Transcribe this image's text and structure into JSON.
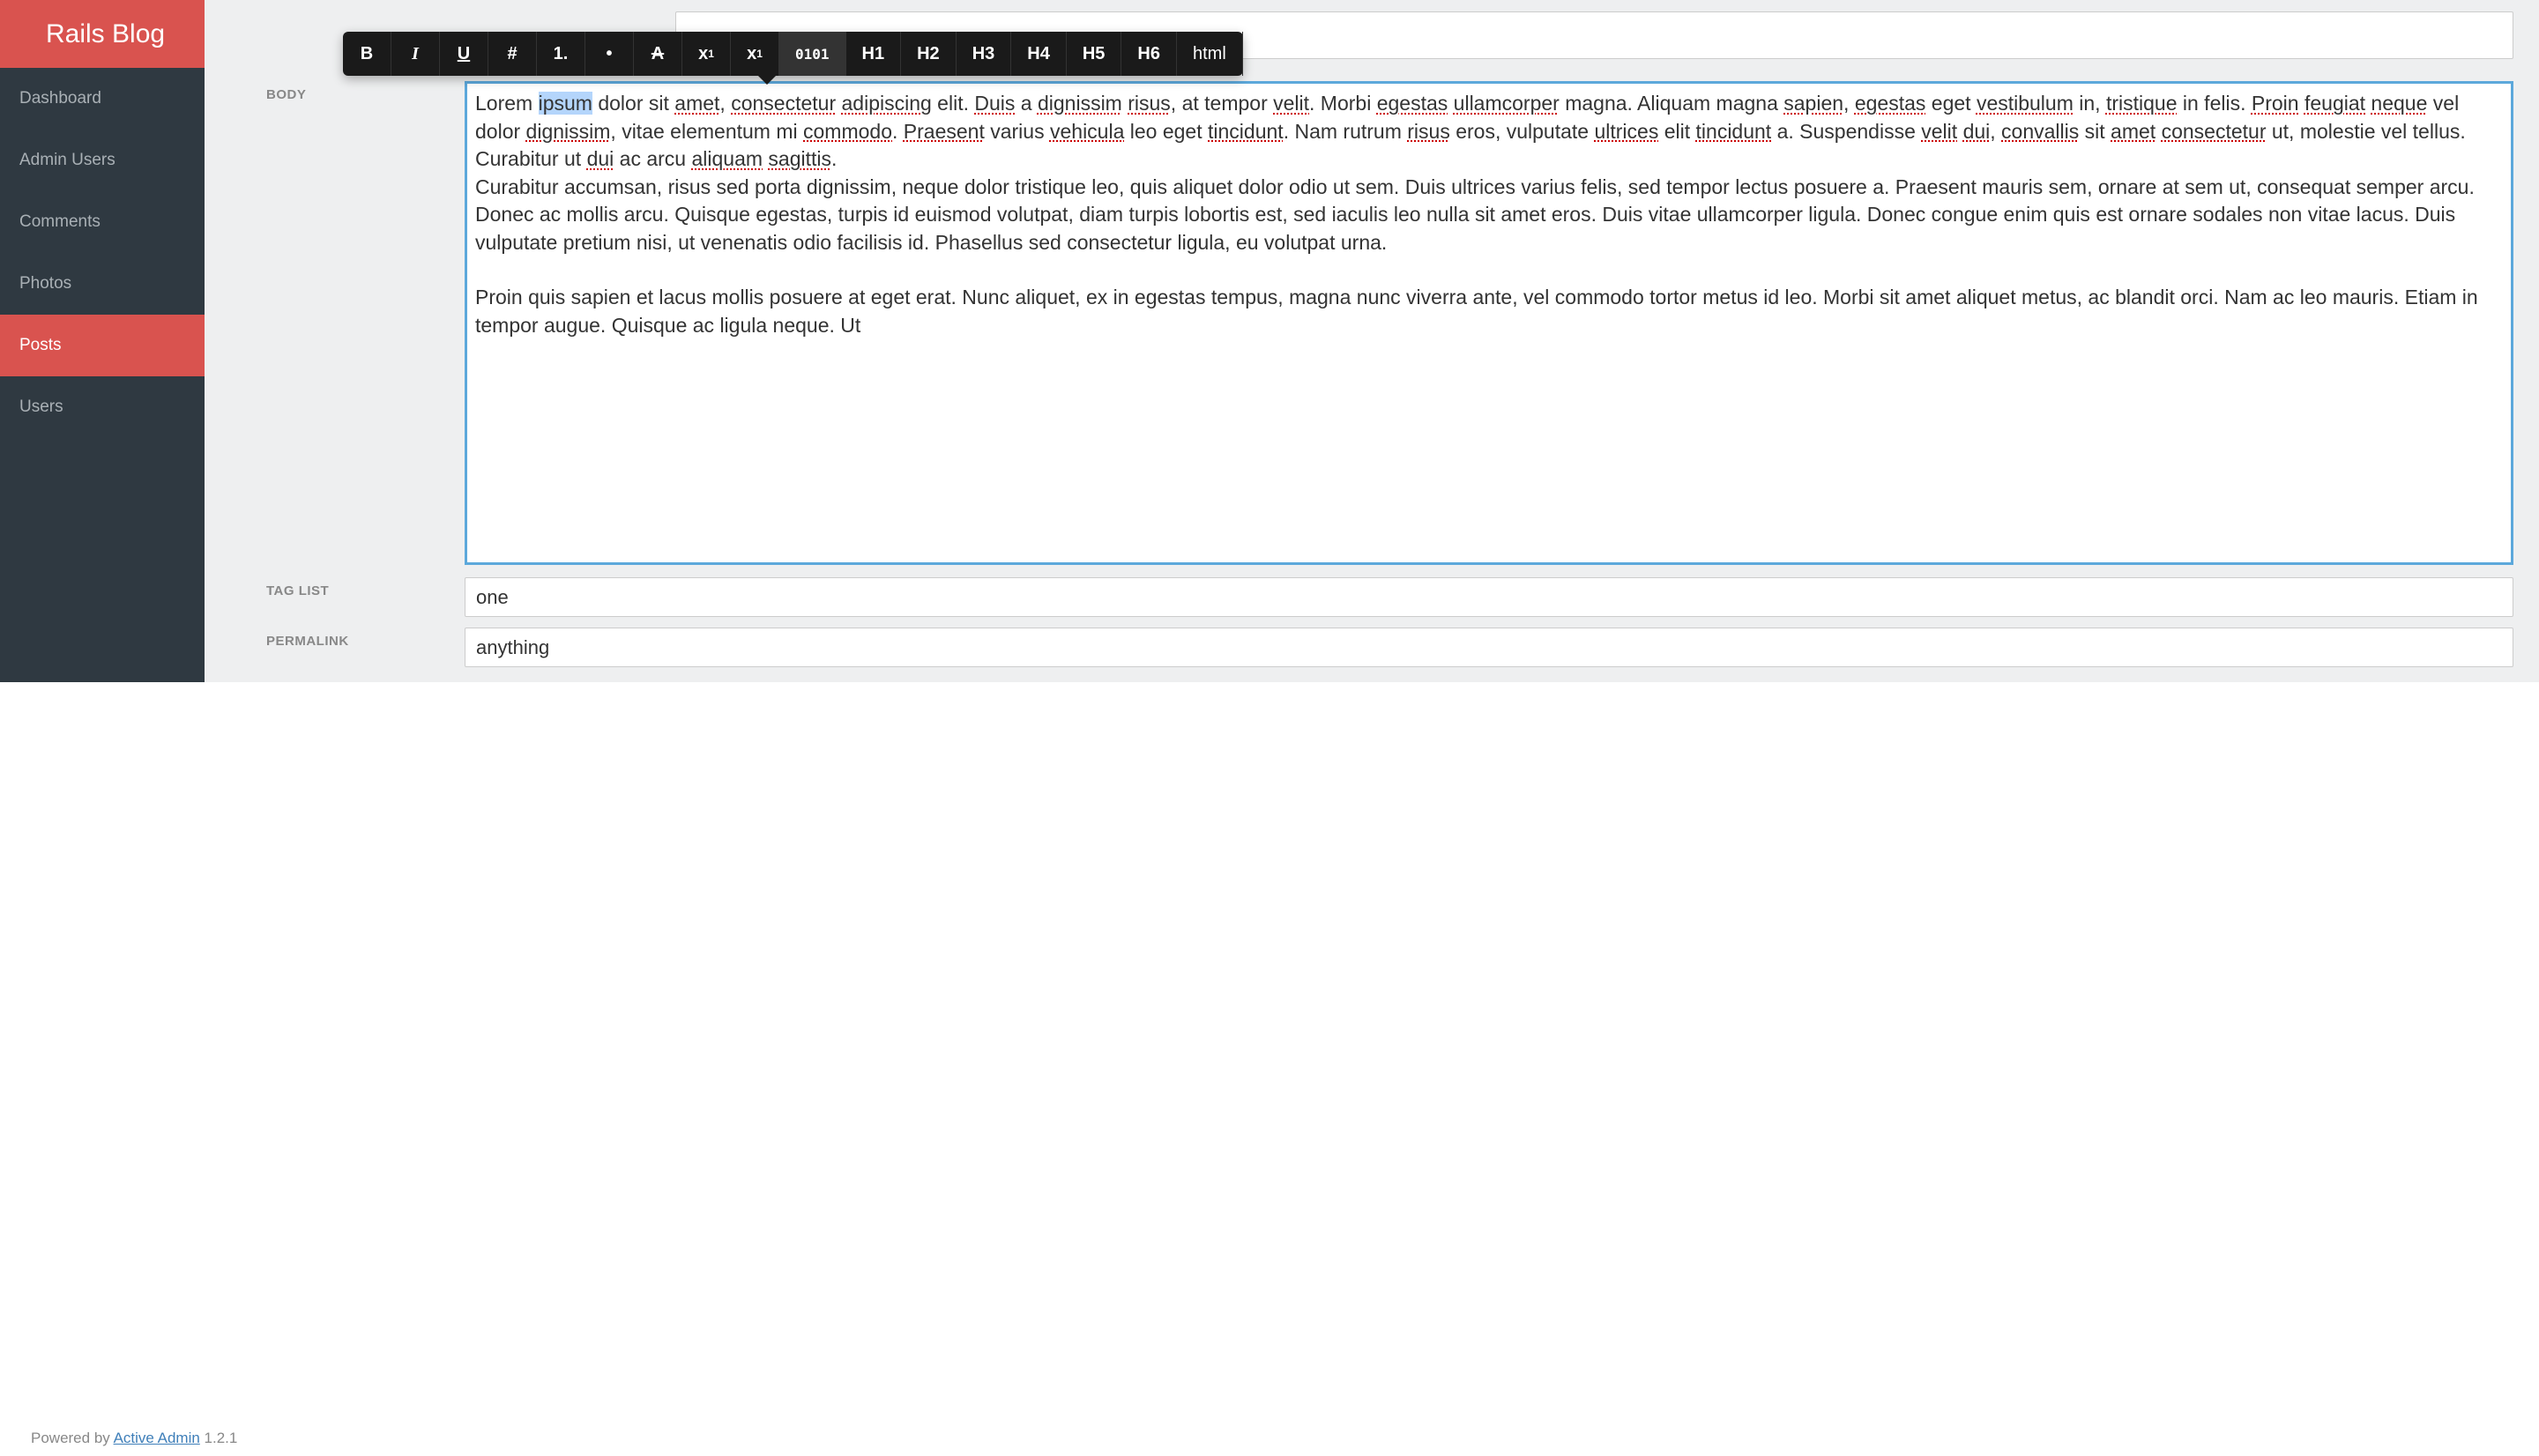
{
  "header": {
    "title": "Rails Blog"
  },
  "sidebar": {
    "items": [
      {
        "label": "Dashboard",
        "active": false
      },
      {
        "label": "Admin Users",
        "active": false
      },
      {
        "label": "Comments",
        "active": false
      },
      {
        "label": "Photos",
        "active": false
      },
      {
        "label": "Posts",
        "active": true
      },
      {
        "label": "Users",
        "active": false
      }
    ]
  },
  "toolbar": {
    "bold": "B",
    "italic": "I",
    "underline": "U",
    "hash": "#",
    "ordered_list": "1.",
    "bullet": "•",
    "strikethrough": "A",
    "subscript_base": "x",
    "subscript_sub": "1",
    "superscript_base": "x",
    "superscript_sup": "1",
    "code": "0101",
    "h1": "H1",
    "h2": "H2",
    "h3": "H3",
    "h4": "H4",
    "h5": "H5",
    "h6": "H6",
    "html": "html"
  },
  "form": {
    "body_label": "BODY",
    "tag_list_label": "TAG LIST",
    "tag_list_value": "one",
    "permalink_label": "PERMALINK",
    "permalink_value": "anything",
    "body_paragraphs": {
      "p1_pre": "Lorem ",
      "p1_selected": "ipsum",
      "p1_post": " dolor sit ",
      "p1_w1": "amet",
      "p1_t2": ", ",
      "p1_w2": "consectetur",
      "p1_t3": " ",
      "p1_w3": "adipiscing",
      "p1_t4": " elit. ",
      "p1_w4": "Duis",
      "p1_t5": " a ",
      "p1_w5": "dignissim",
      "p1_t6": " ",
      "p1_w6": "risus",
      "p1_t7": ", at tempor ",
      "p1_w7": "velit",
      "p1_t8": ". Morbi ",
      "p1_w8": "egestas",
      "p1_t9": " ",
      "p1_w9": "ullamcorper",
      "p1_t10": " magna. Aliquam magna ",
      "p1_w10": "sapien",
      "p1_t11": ", ",
      "p1_w11": "egestas",
      "p1_t12": " eget ",
      "p1_w12": "vestibulum",
      "p1_t13": " in, ",
      "p1_w13": "tristique",
      "p1_t14": " in felis. ",
      "p1_w14": "Proin",
      "p1_t15": " ",
      "p1_w15": "feugiat",
      "p1_t16": " ",
      "p1_w16": "neque",
      "p1_t17": " vel dolor ",
      "p1_w17": "dignissim",
      "p1_t18": ", vitae elementum mi ",
      "p1_w18": "commodo",
      "p1_t19": ". ",
      "p1_w19": "Praesent",
      "p1_t20": " varius ",
      "p1_w20": "vehicula",
      "p1_t21": " leo eget ",
      "p1_w21": "tincidunt",
      "p1_t22": ". Nam rutrum ",
      "p1_w22": "risus",
      "p1_t23": " eros, vulputate ",
      "p1_w23": "ultrices",
      "p1_t24": " elit ",
      "p1_w24": "tincidunt",
      "p1_t25": " a. Suspendisse ",
      "p1_w25": "velit",
      "p1_t26": " ",
      "p1_w26": "dui",
      "p1_t27": ", ",
      "p1_w27": "convallis",
      "p1_t28": " sit ",
      "p1_w28": "amet",
      "p1_t29": " ",
      "p1_w29": "consectetur",
      "p1_t30": " ut, molestie vel tellus. Curabitur ut ",
      "p1_w30": "dui",
      "p1_t31": " ac arcu ",
      "p1_w31": "aliquam",
      "p1_t32": " ",
      "p1_w32": "sagittis",
      "p1_t33": ".",
      "p2": "Curabitur accumsan, risus sed porta dignissim, neque dolor tristique leo, quis aliquet dolor odio ut sem. Duis ultrices varius felis, sed tempor lectus posuere a. Praesent mauris sem, ornare at sem ut, consequat semper arcu. Donec ac mollis arcu. Quisque egestas, turpis id euismod volutpat, diam turpis lobortis est, sed iaculis leo nulla sit amet eros. Duis vitae ullamcorper ligula. Donec congue enim quis est ornare sodales non vitae lacus. Duis vulputate pretium nisi, ut venenatis odio facilisis id. Phasellus sed consectetur ligula, eu volutpat urna.",
      "p3": "Proin quis sapien et lacus mollis posuere at eget erat. Nunc aliquet, ex in egestas tempus, magna nunc viverra ante, vel commodo tortor metus id leo. Morbi sit amet aliquet metus, ac blandit orci. Nam ac leo mauris. Etiam in tempor augue. Quisque ac ligula neque. Ut"
    }
  },
  "footer": {
    "prefix": "Powered by ",
    "link": "Active Admin",
    "version": " 1.2.1"
  }
}
